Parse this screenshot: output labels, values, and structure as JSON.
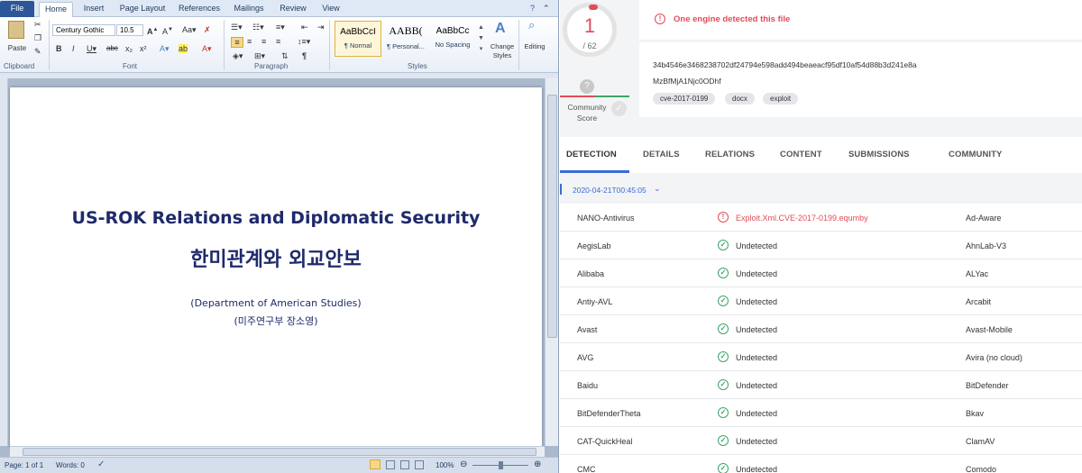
{
  "word": {
    "tabs": [
      "File",
      "Home",
      "Insert",
      "Page Layout",
      "References",
      "Mailings",
      "Review",
      "View"
    ],
    "ribbon": {
      "paste_label": "Paste",
      "font_name": "Century Gothic",
      "font_size": "10.5",
      "groups": [
        "Clipboard",
        "Font",
        "Paragraph",
        "Styles"
      ],
      "styles": [
        {
          "sample": "AaBbCcI",
          "label": "¶ Normal"
        },
        {
          "sample": "AABB(",
          "label": "¶ Personal..."
        },
        {
          "sample": "AaBbCc",
          "label": "No Spacing"
        }
      ],
      "change_styles": "Change Styles",
      "editing": "Editing"
    },
    "document": {
      "title_en": "US-ROK Relations and Diplomatic Security",
      "title_ko": "한미관계와 외교안보",
      "dept_en": "(Department of American Studies)",
      "dept_ko": "(미주연구부 장소영)"
    },
    "status": {
      "page": "Page: 1 of 1",
      "words": "Words: 0",
      "zoom": "100%"
    }
  },
  "vt": {
    "score": "1",
    "score_total": "/ 62",
    "community_label": "Community Score",
    "alert": "One engine detected this file",
    "hash": "34b4546e3468238702df24794e598add494beaeacf95df10af54d88b3d241e8a",
    "filename": "MzBfMjA1Njc0ODhf",
    "tags": [
      "cve-2017-0199",
      "docx",
      "exploit"
    ],
    "tabs": [
      "DETECTION",
      "DETAILS",
      "RELATIONS",
      "CONTENT",
      "SUBMISSIONS",
      "COMMUNITY"
    ],
    "scan_date": "2020-04-21T00:45:05",
    "detections": [
      {
        "engine": "NANO-Antivirus",
        "result": "Exploit.Xml.CVE-2017-0199.equmby",
        "malicious": true,
        "engine2": "Ad-Aware"
      },
      {
        "engine": "AegisLab",
        "result": "Undetected",
        "malicious": false,
        "engine2": "AhnLab-V3"
      },
      {
        "engine": "Alibaba",
        "result": "Undetected",
        "malicious": false,
        "engine2": "ALYac"
      },
      {
        "engine": "Antiy-AVL",
        "result": "Undetected",
        "malicious": false,
        "engine2": "Arcabit"
      },
      {
        "engine": "Avast",
        "result": "Undetected",
        "malicious": false,
        "engine2": "Avast-Mobile"
      },
      {
        "engine": "AVG",
        "result": "Undetected",
        "malicious": false,
        "engine2": "Avira (no cloud)"
      },
      {
        "engine": "Baidu",
        "result": "Undetected",
        "malicious": false,
        "engine2": "BitDefender"
      },
      {
        "engine": "BitDefenderTheta",
        "result": "Undetected",
        "malicious": false,
        "engine2": "Bkav"
      },
      {
        "engine": "CAT-QuickHeal",
        "result": "Undetected",
        "malicious": false,
        "engine2": "ClamAV"
      },
      {
        "engine": "CMC",
        "result": "Undetected",
        "malicious": false,
        "engine2": "Comodo"
      }
    ],
    "colors": {
      "accent": "#3a6bd6",
      "danger": "#e44b57",
      "ok": "#3ea46a"
    }
  }
}
